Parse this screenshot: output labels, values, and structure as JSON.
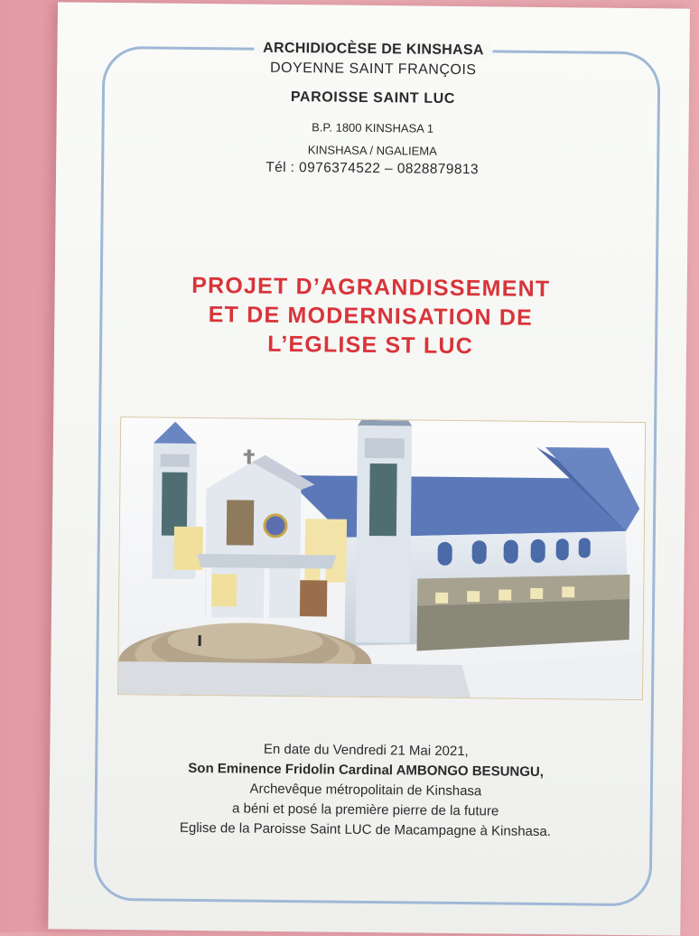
{
  "header": {
    "archidiocese": "ARCHIDIOCÈSE DE KINSHASA",
    "doyenne": "DOYENNE SAINT FRANÇOIS",
    "paroisse": "PAROISSE SAINT LUC",
    "bp": "B.P. 1800 KINSHASA 1",
    "location": "KINSHASA / NGALIEMA",
    "telephone": "Tél : 0976374522 – 0828879813"
  },
  "project_title": {
    "line1": "PROJET D’AGRANDISSEMENT",
    "line2": "ET DE MODERNISATION DE",
    "line3": "L’EGLISE ST LUC"
  },
  "image": {
    "icon": "church-rendering-image"
  },
  "caption": {
    "line1": "En date du Vendredi 21 Mai 2021,",
    "line2": "Son Eminence Fridolin Cardinal AMBONGO BESUNGU,",
    "line3": "Archevêque métropolitain de Kinshasa",
    "line4": "a béni et posé la première pierre de la future",
    "line5": "Eglise de la Paroisse Saint LUC de Macampagne à Kinshasa."
  },
  "colors": {
    "background": "#e8a6ae",
    "paper": "#f8f9f6",
    "frame": "#9fb8d6",
    "title_red": "#d8343a",
    "roof_blue": "#5b78b8"
  }
}
